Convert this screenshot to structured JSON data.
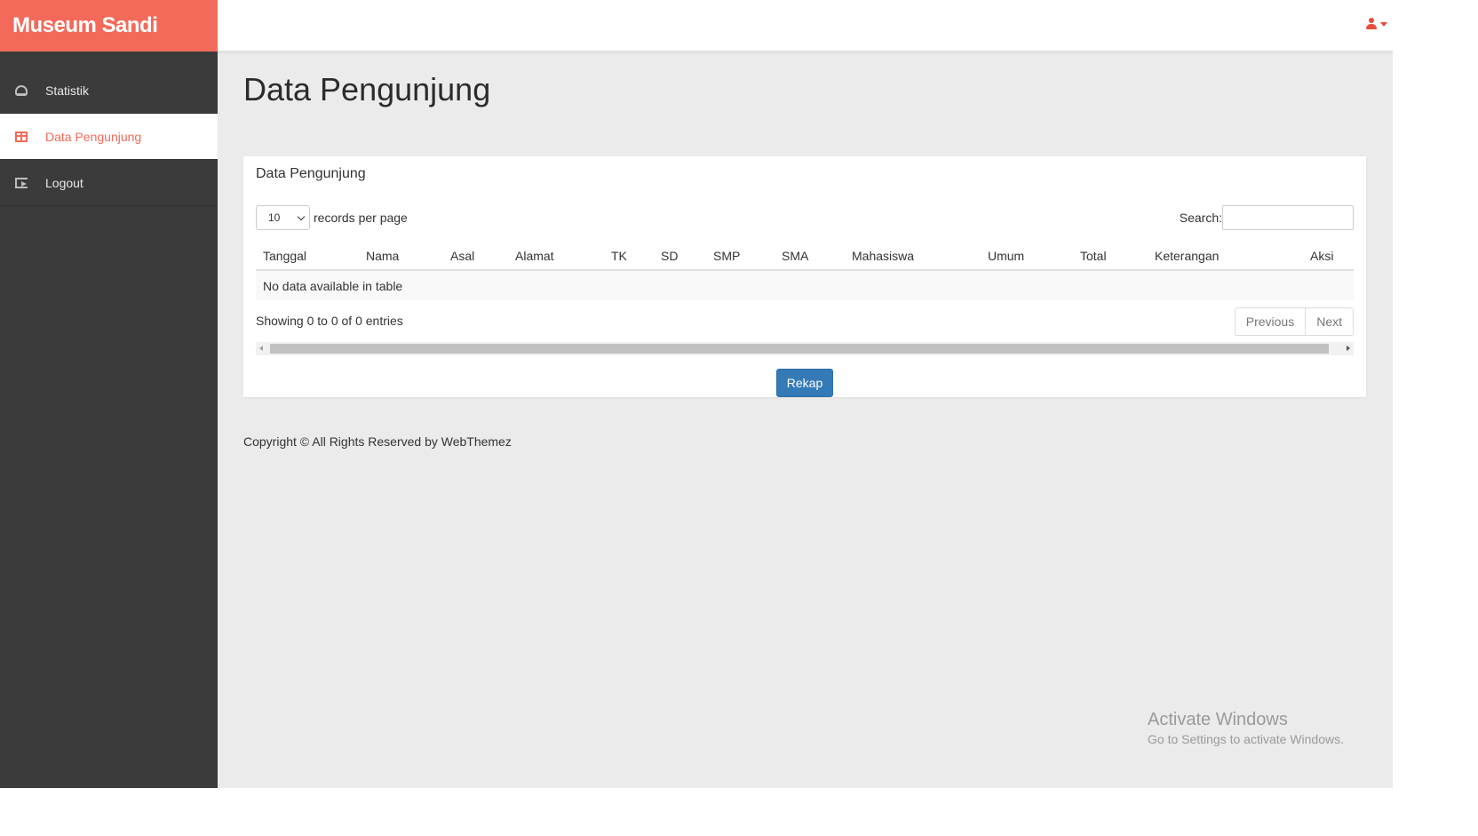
{
  "app": {
    "brand": "Museum Sandi"
  },
  "sidebar": {
    "items": [
      {
        "label": "Statistik",
        "icon": "dashboard-icon",
        "active": false
      },
      {
        "label": "Data Pengunjung",
        "icon": "table-icon",
        "active": true
      },
      {
        "label": "Logout",
        "icon": "sign-out-icon",
        "active": false
      }
    ]
  },
  "page": {
    "title": "Data Pengunjung"
  },
  "panel": {
    "heading": "Data Pengunjung",
    "length": {
      "selected": "10",
      "suffix": "records per page"
    },
    "search": {
      "label": "Search:",
      "value": ""
    },
    "table": {
      "columns": [
        "Tanggal",
        "Nama",
        "Asal",
        "Alamat",
        "TK",
        "SD",
        "SMP",
        "SMA",
        "Mahasiswa",
        "Umum",
        "Total",
        "Keterangan",
        "Aksi"
      ],
      "empty_message": "No data available in table"
    },
    "info": "Showing 0 to 0 of 0 entries",
    "pager": {
      "previous": "Previous",
      "next": "Next"
    },
    "rekap_label": "Rekap"
  },
  "footer": {
    "text": "Copyright © All Rights Reserved by WebThemez"
  },
  "watermark": {
    "line1": "Activate Windows",
    "line2": "Go to Settings to activate Windows."
  },
  "colors": {
    "brand": "#f36a5a",
    "sidebar": "#3b3b3b",
    "primary_button": "#337ab7",
    "background": "#ebebeb"
  }
}
